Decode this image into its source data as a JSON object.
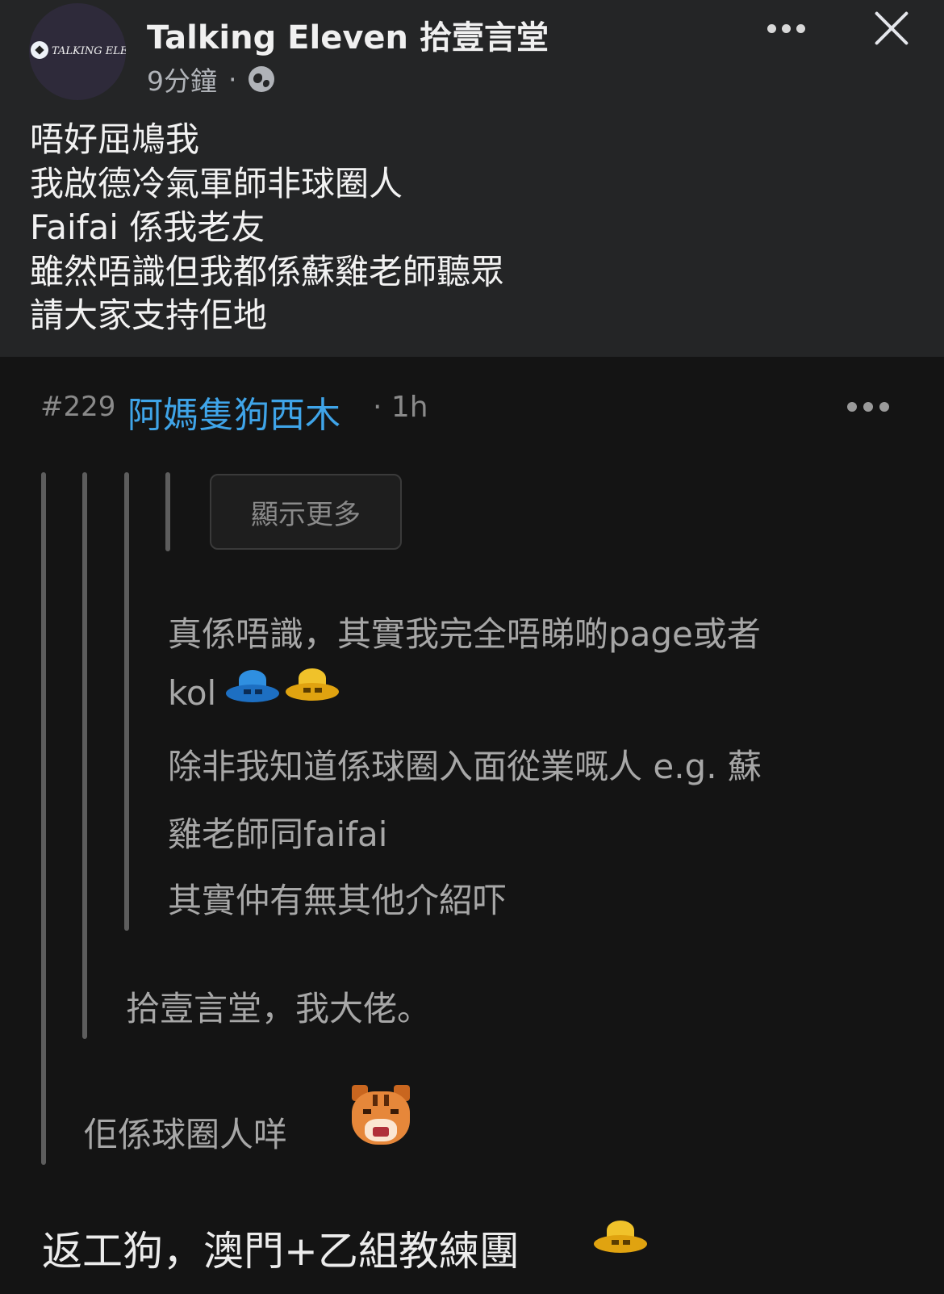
{
  "post": {
    "page_name": "Talking Eleven 拾壹言堂",
    "avatar_logo_text": "TALKING ELEVEN",
    "time": "9分鐘",
    "separator": "·",
    "lines": [
      "唔好屈鳩我",
      "我啟德冷氣軍師非球圈人",
      "Faifai 係我老友",
      "雖然唔識但我都係蘇雞老師聽眾",
      "請大家支持佢地"
    ]
  },
  "comment": {
    "number": "#229",
    "username": "阿媽隻狗西木",
    "time": "· 1h",
    "show_more_label": "顯示更多",
    "quote3_lines": [
      "真係唔識，其實我完全唔睇啲page或者",
      "kol",
      "除非我知道係球圈入面從業嘅人 e.g. 蘇",
      "雞老師同faifai",
      "其實仲有無其他介紹吓"
    ],
    "quote2_text": "拾壹言堂，我大佬。",
    "quote1_text": "佢係球圈人咩",
    "reply_text": "返工狗，澳門+乙組教練團"
  },
  "colors": {
    "fb_background": "#242526",
    "forum_background": "#141414",
    "username": "#3fa4e8",
    "quote_text": "#a7a7a7"
  },
  "icons": [
    "globe-icon",
    "more-icon",
    "close-icon",
    "ufo-blue-emoji",
    "ufo-yellow-emoji",
    "tiger-emoji"
  ]
}
